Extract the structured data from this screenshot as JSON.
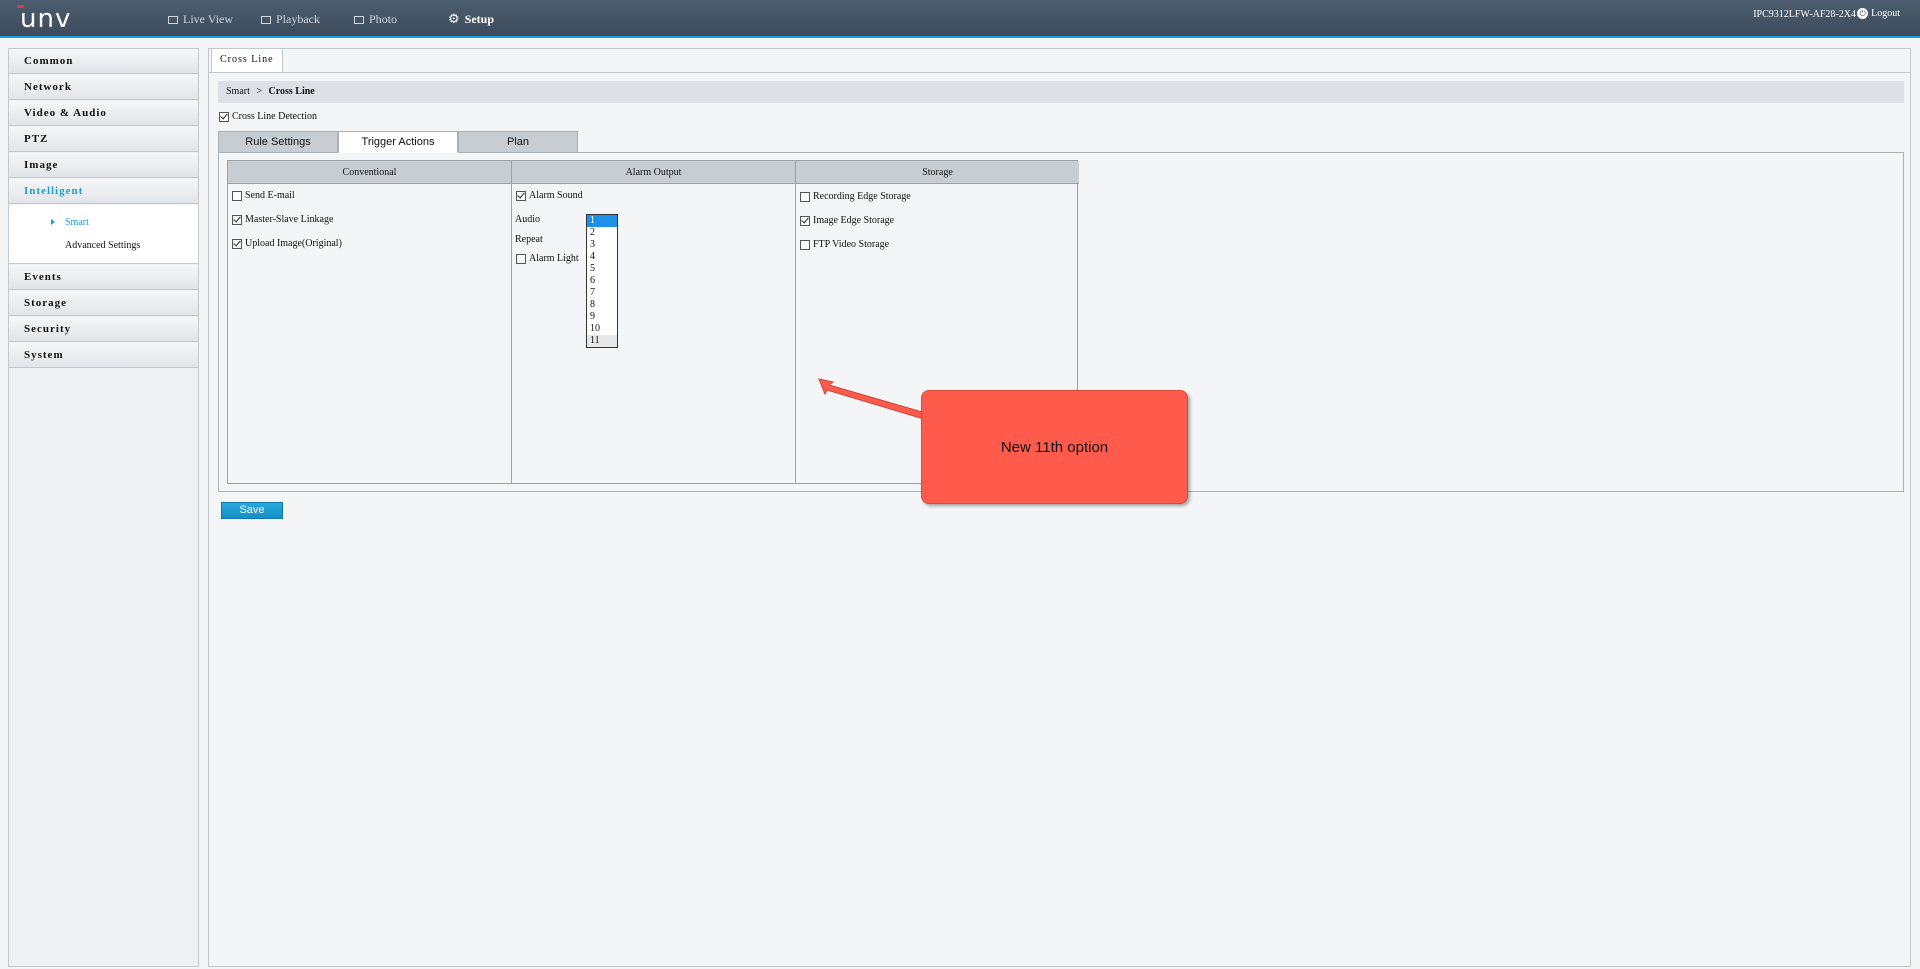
{
  "header": {
    "logo": "unv",
    "nav": [
      {
        "label": "Live View",
        "icon": "monitor-icon"
      },
      {
        "label": "Playback",
        "icon": "film-icon"
      },
      {
        "label": "Photo",
        "icon": "photo-icon"
      },
      {
        "label": "Setup",
        "icon": "gear-icon"
      }
    ],
    "device_name": "IPC9312LFW-AF28-2X4",
    "logout_label": "Logout"
  },
  "sidebar": {
    "items": [
      {
        "label": "Common"
      },
      {
        "label": "Network"
      },
      {
        "label": "Video & Audio"
      },
      {
        "label": "PTZ"
      },
      {
        "label": "Image"
      },
      {
        "label": "Intelligent"
      },
      {
        "label": "Events"
      },
      {
        "label": "Storage"
      },
      {
        "label": "Security"
      },
      {
        "label": "System"
      }
    ],
    "sub_items": [
      {
        "label": "Smart"
      },
      {
        "label": "Advanced Settings"
      }
    ]
  },
  "content": {
    "page_tab": "Cross Line",
    "breadcrumb": {
      "parent": "Smart",
      "separator": ">",
      "current": "Cross Line"
    },
    "detection_label": "Cross Line Detection",
    "tabs": [
      {
        "label": "Rule Settings"
      },
      {
        "label": "Trigger Actions"
      },
      {
        "label": "Plan"
      }
    ],
    "columns": {
      "conventional": {
        "title": "Conventional",
        "options": [
          {
            "label": "Send E-mail",
            "checked": false
          },
          {
            "label": "Master-Slave Linkage",
            "checked": true
          },
          {
            "label": "Upload Image(Original)",
            "checked": true
          }
        ]
      },
      "alarm_output": {
        "title": "Alarm Output",
        "alarm_sound_label": "Alarm Sound",
        "alarm_sound_checked": true,
        "audio_label": "Audio",
        "repeat_label": "Repeat",
        "alarm_light_label": "Alarm Light",
        "alarm_light_checked": false,
        "audio_options": [
          "1",
          "2",
          "3",
          "4",
          "5",
          "6",
          "7",
          "8",
          "9",
          "10",
          "11"
        ],
        "audio_selected": "1"
      },
      "storage": {
        "title": "Storage",
        "options": [
          {
            "label": "Recording Edge Storage",
            "checked": false
          },
          {
            "label": "Image Edge Storage",
            "checked": true
          },
          {
            "label": "FTP Video Storage",
            "checked": false
          }
        ]
      }
    },
    "save_label": "Save"
  },
  "annotation": {
    "text": "New 11th option",
    "color": "#ff5b4c"
  }
}
